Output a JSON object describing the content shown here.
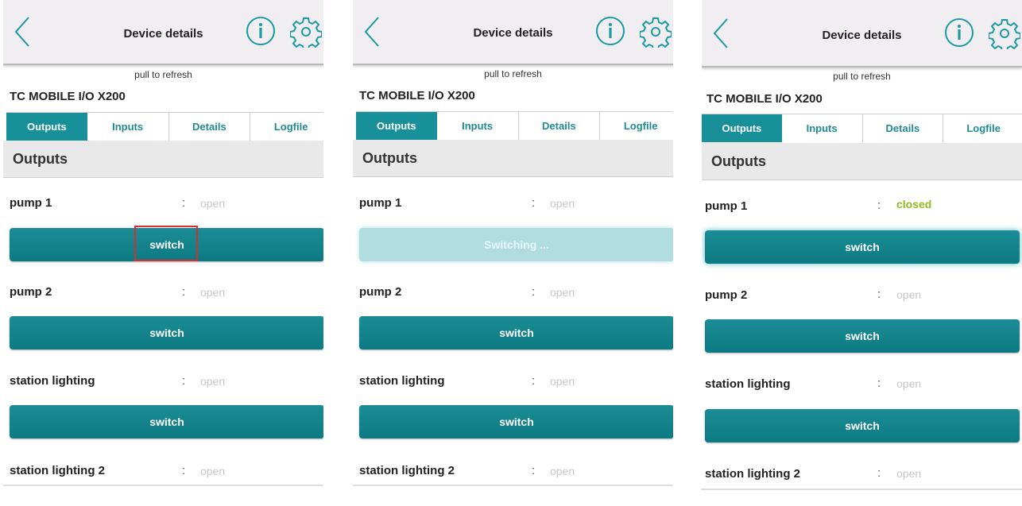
{
  "header": {
    "title": "Device details"
  },
  "refresh_hint": "pull to refresh",
  "device_name": "TC MOBILE I/O X200",
  "tabs": [
    {
      "label": "Outputs"
    },
    {
      "label": "Inputs"
    },
    {
      "label": "Details"
    },
    {
      "label": "Logfile"
    }
  ],
  "section_title": "Outputs",
  "colon": ":",
  "panels": [
    {
      "outputs": [
        {
          "name": "pump 1",
          "status": "open",
          "button": "switch"
        },
        {
          "name": "pump 2",
          "status": "open",
          "button": "switch"
        },
        {
          "name": "station lighting",
          "status": "open",
          "button": "switch"
        },
        {
          "name": "station lighting 2",
          "status": "open"
        }
      ]
    },
    {
      "outputs": [
        {
          "name": "pump 1",
          "status": "open",
          "button": "Switching ..."
        },
        {
          "name": "pump 2",
          "status": "open",
          "button": "switch"
        },
        {
          "name": "station lighting",
          "status": "open",
          "button": "switch"
        },
        {
          "name": "station lighting 2",
          "status": "open"
        }
      ]
    },
    {
      "outputs": [
        {
          "name": "pump 1",
          "status": "closed",
          "button": "switch"
        },
        {
          "name": "pump 2",
          "status": "open",
          "button": "switch"
        },
        {
          "name": "station lighting",
          "status": "open",
          "button": "switch"
        },
        {
          "name": "station lighting 2",
          "status": "open"
        }
      ]
    }
  ],
  "colors": {
    "accent": "#18909a",
    "closed_status": "#8ebc1f",
    "open_status": "#c6c6c6",
    "highlight": "#d32f2f"
  }
}
